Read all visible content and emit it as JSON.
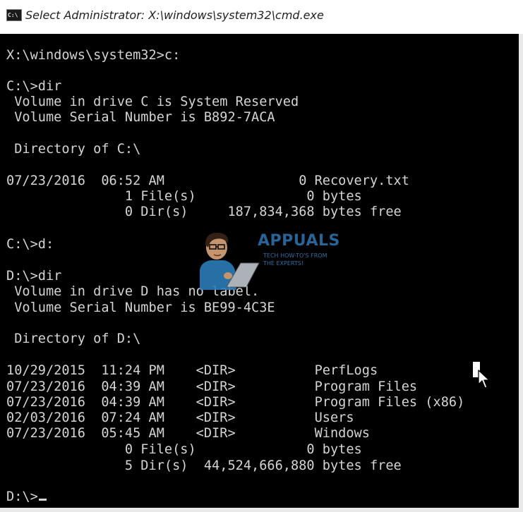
{
  "window": {
    "title": "Select Administrator: X:\\windows\\system32\\cmd.exe",
    "icon_label": "C:\\"
  },
  "console": {
    "lines": [
      "X:\\windows\\system32>c:",
      "",
      "C:\\>dir",
      " Volume in drive C is System Reserved",
      " Volume Serial Number is B892-7ACA",
      "",
      " Directory of C:\\",
      "",
      "07/23/2016  06:52 AM                 0 Recovery.txt",
      "               1 File(s)              0 bytes",
      "               0 Dir(s)     187,834,368 bytes free",
      "",
      "C:\\>d:",
      "",
      "D:\\>dir",
      " Volume in drive D has no label.",
      " Volume Serial Number is BE99-4C3E",
      "",
      " Directory of D:\\",
      "",
      "10/29/2015  11:24 PM    <DIR>          PerfLogs",
      "07/23/2016  04:39 AM    <DIR>          Program Files",
      "07/23/2016  04:39 AM    <DIR>          Program Files (x86)",
      "02/03/2016  07:24 AM    <DIR>          Users",
      "07/23/2016  05:45 AM    <DIR>          Windows",
      "               0 File(s)              0 bytes",
      "               5 Dir(s)  44,524,666,880 bytes free",
      "",
      "D:\\>"
    ]
  },
  "watermark": {
    "brand": "APPUALS",
    "tagline_1": "TECH HOW-TO'S FROM",
    "tagline_2": "THE EXPERTS!",
    "icon": "appuals-mascot-icon"
  },
  "colors": {
    "console_bg": "#000000",
    "console_fg": "#d4d4d4",
    "titlebar_bg": "#ffffff",
    "brand": "#2d6fa8"
  }
}
